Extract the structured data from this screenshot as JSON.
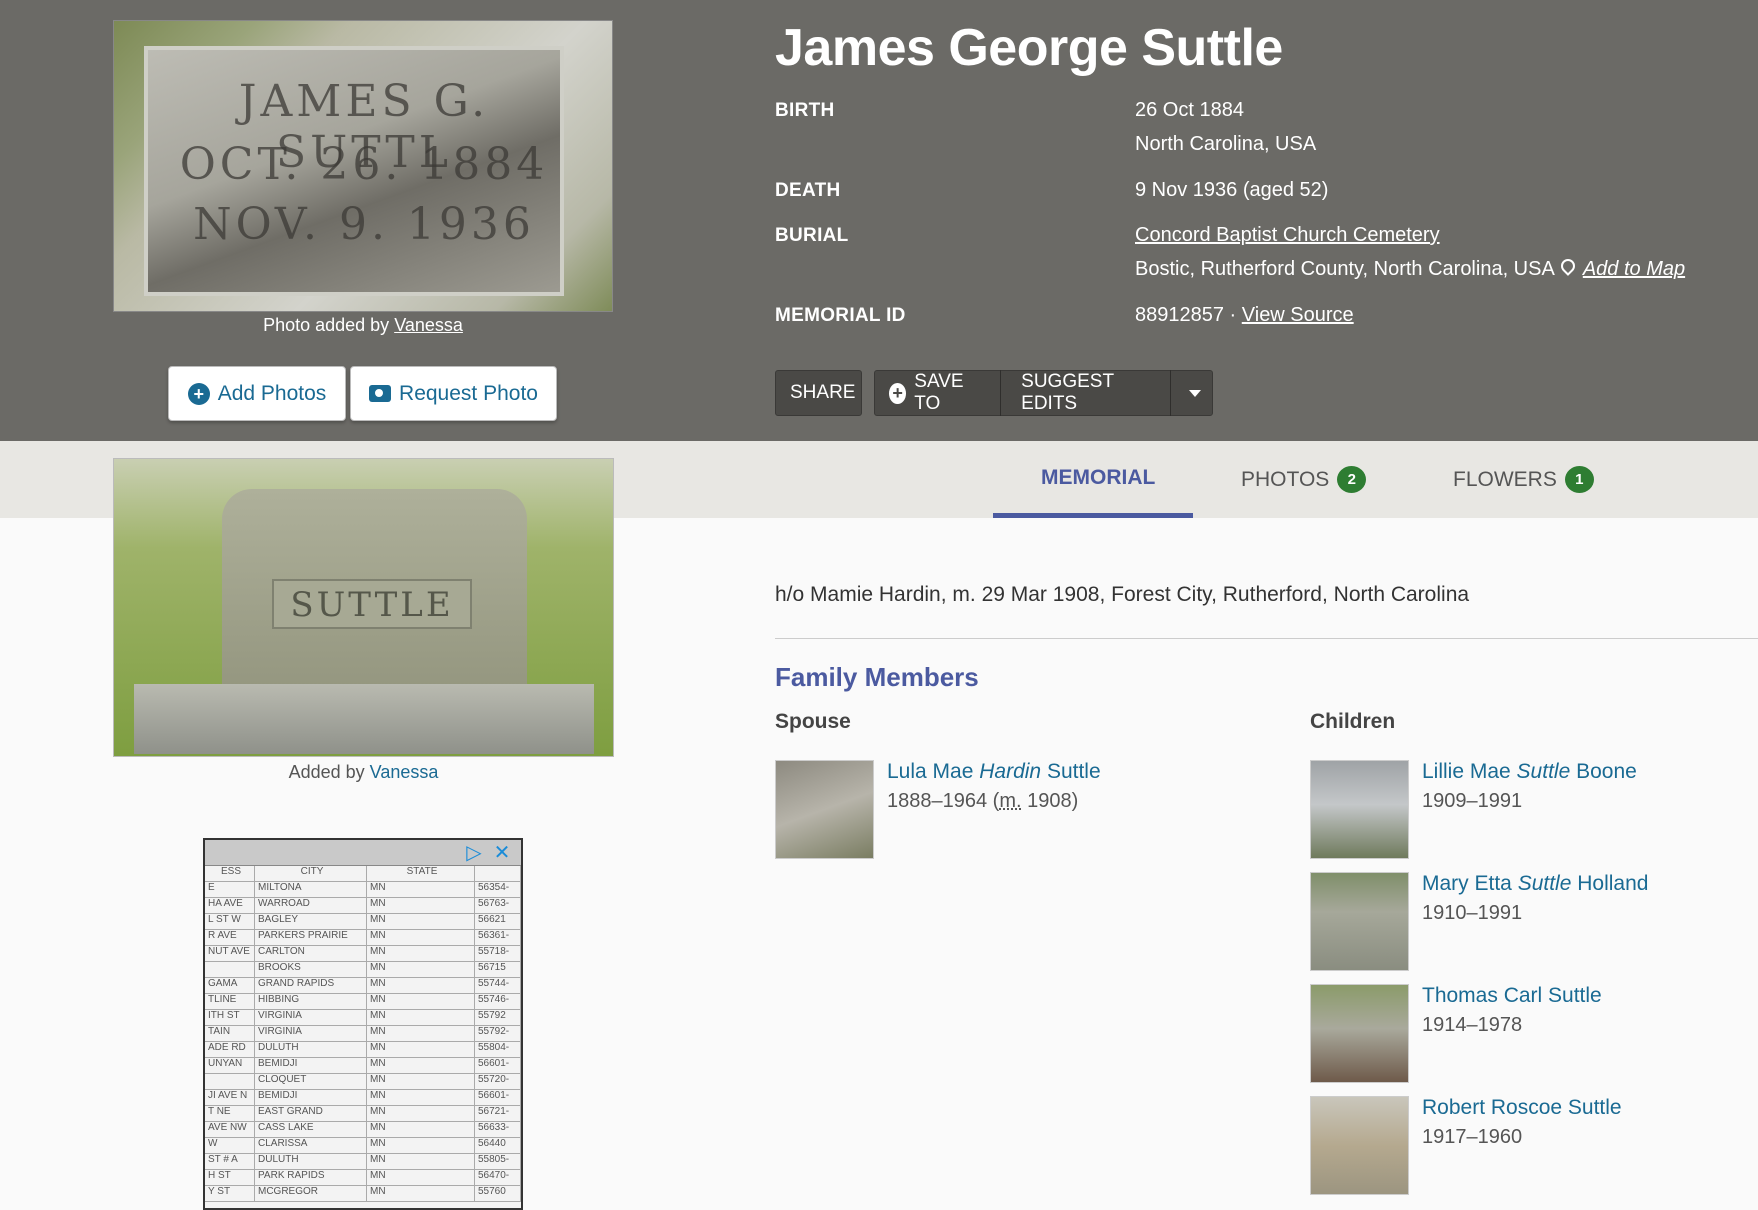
{
  "header": {
    "name": "James George Suttle",
    "birth_label": "BIRTH",
    "birth_date": "26 Oct 1884",
    "birth_place": "North Carolina, USA",
    "death_label": "DEATH",
    "death_value": "9 Nov 1936 (aged 52)",
    "burial_label": "BURIAL",
    "cemetery": "Concord Baptist Church Cemetery",
    "burial_place": "Bostic, Rutherford County, North Carolina, USA",
    "add_to_map": "Add to Map",
    "memorial_id_label": "MEMORIAL ID",
    "memorial_id": "88912857",
    "id_separator": " · ",
    "view_source": "View Source"
  },
  "photo1": {
    "engraving": [
      "JAMES G. SUTTL",
      "OCT. 26. 1884",
      "NOV. 9. 1936"
    ],
    "caption_prefix": "Photo added by ",
    "caption_user": "Vanessa"
  },
  "photo_buttons": {
    "add_photos": "Add Photos",
    "request_photo": "Request Photo"
  },
  "actions": {
    "share": "SHARE",
    "save_to": "SAVE TO",
    "suggest_edits": "SUGGEST EDITS"
  },
  "tabs": {
    "memorial": "MEMORIAL",
    "photos": "PHOTOS",
    "photos_count": "2",
    "flowers": "FLOWERS",
    "flowers_count": "1"
  },
  "photo2": {
    "plate_text": "SUTTLE",
    "caption_prefix": "Added by ",
    "caption_user": "Vanessa"
  },
  "ad": {
    "headers": [
      "ESS",
      "CITY",
      "STATE"
    ],
    "rows": [
      [
        "E",
        "MILTONA",
        "MN",
        "56354-"
      ],
      [
        "HA AVE",
        "WARROAD",
        "MN",
        "56763-"
      ],
      [
        "L ST W",
        "BAGLEY",
        "MN",
        "56621"
      ],
      [
        "R AVE",
        "PARKERS PRAIRIE",
        "MN",
        "56361-"
      ],
      [
        "NUT AVE",
        "CARLTON",
        "MN",
        "55718-"
      ],
      [
        "",
        "BROOKS",
        "MN",
        "56715"
      ],
      [
        "GAMA",
        "GRAND RAPIDS",
        "MN",
        "55744-"
      ],
      [
        "TLINE",
        "HIBBING",
        "MN",
        "55746-"
      ],
      [
        "ITH ST",
        "VIRGINIA",
        "MN",
        "55792"
      ],
      [
        "TAIN",
        "VIRGINIA",
        "MN",
        "55792-"
      ],
      [
        "ADE RD",
        "DULUTH",
        "MN",
        "55804-"
      ],
      [
        "UNYAN",
        "BEMIDJI",
        "MN",
        "56601-"
      ],
      [
        "",
        "CLOQUET",
        "MN",
        "55720-"
      ],
      [
        "JI AVE N",
        "BEMIDJI",
        "MN",
        "56601-"
      ],
      [
        "T NE",
        "EAST GRAND",
        "MN",
        "56721-"
      ],
      [
        "AVE NW",
        "CASS LAKE",
        "MN",
        "56633-"
      ],
      [
        "W",
        "CLARISSA",
        "MN",
        "56440"
      ],
      [
        "ST # A",
        "DULUTH",
        "MN",
        "55805-"
      ],
      [
        "H ST",
        "PARK RAPIDS",
        "MN",
        "56470-"
      ],
      [
        "Y ST",
        "MCGREGOR",
        "MN",
        "55760"
      ]
    ]
  },
  "memorial": {
    "bio": "h/o Mamie Hardin, m. 29 Mar 1908, Forest City, Rutherford, North Carolina",
    "family_title": "Family Members",
    "spouse_label": "Spouse",
    "children_label": "Children",
    "spouse": {
      "first": "Lula Mae ",
      "maiden": "Hardin",
      "last": " Suttle",
      "dates": "1888–1964 (",
      "married_abbr": "m.",
      "married_year": " 1908)"
    },
    "children": [
      {
        "first": "Lillie Mae ",
        "maiden": "Suttle",
        "last": " Boone",
        "dates": "1909–1991"
      },
      {
        "first": "Mary Etta ",
        "maiden": "Suttle",
        "last": " Holland",
        "dates": "1910–1991"
      },
      {
        "first": "Thomas Carl Suttle",
        "maiden": "",
        "last": "",
        "dates": "1914–1978"
      },
      {
        "first": "Robert Roscoe Suttle",
        "maiden": "",
        "last": "",
        "dates": "1917–1960"
      }
    ]
  }
}
